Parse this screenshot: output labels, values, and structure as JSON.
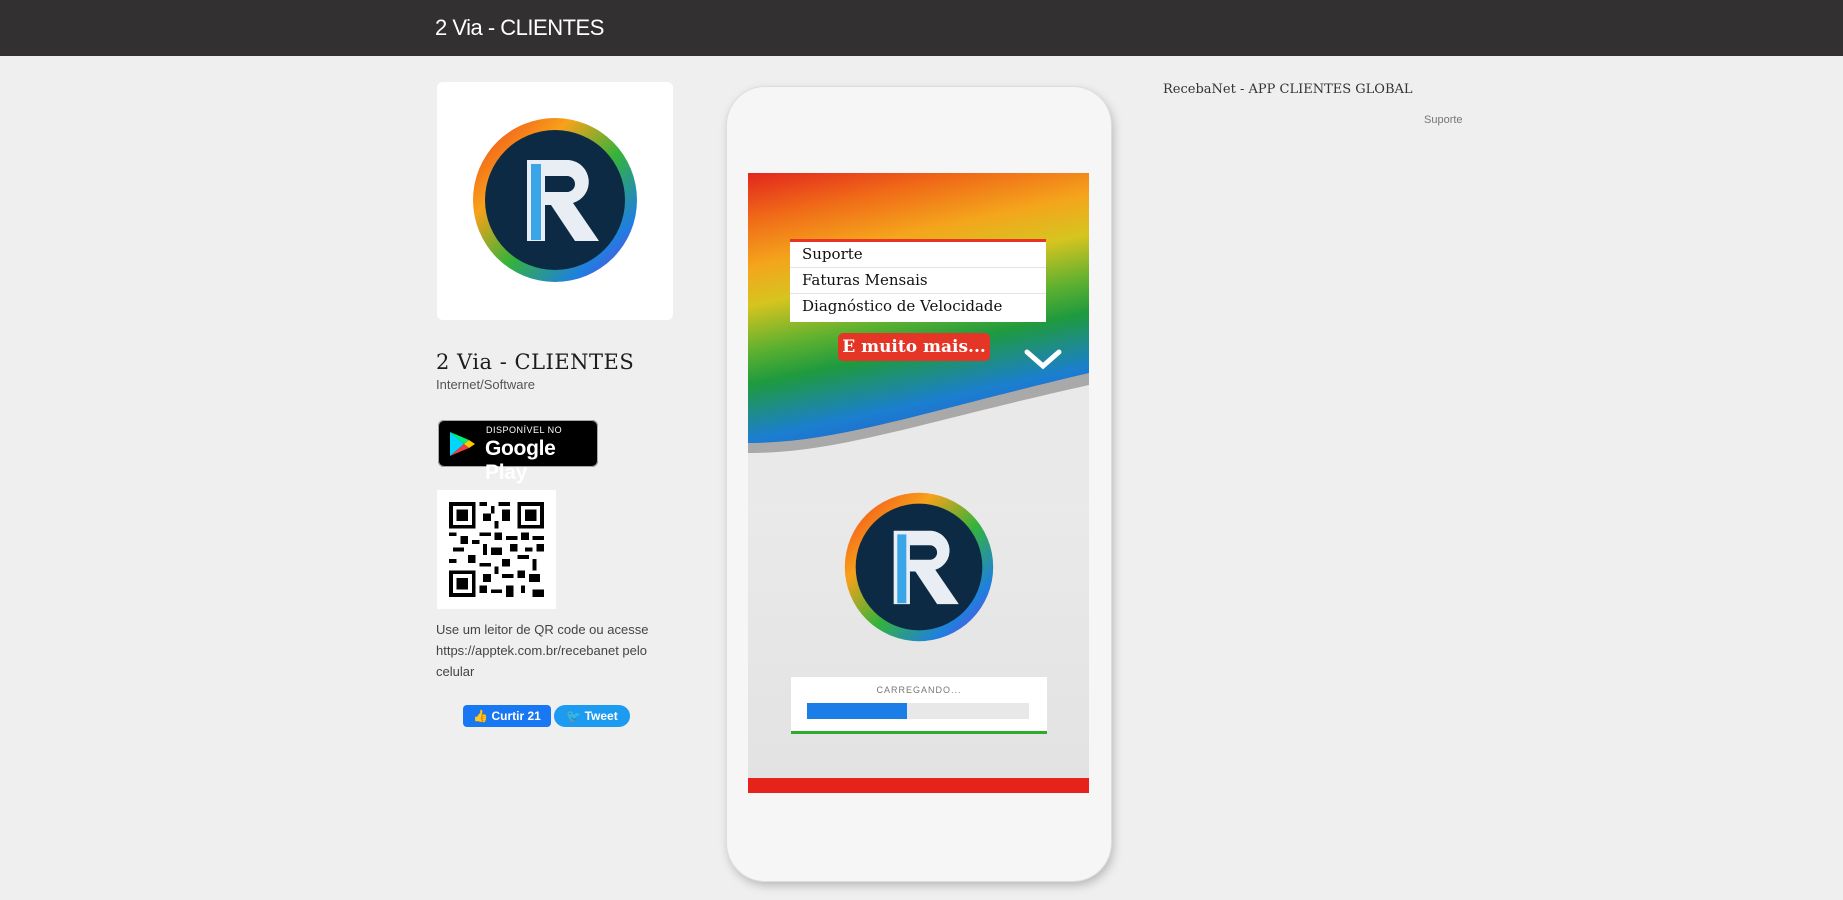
{
  "header": {
    "title": "2 Via - CLIENTES"
  },
  "app": {
    "name": "2 Via - CLIENTES",
    "category": "Internet/Software",
    "store_badge": {
      "small_label": "DISPONÍVEL NO",
      "store_name": "Google Play"
    },
    "qr_text": "Use um leitor de QR code ou acesse https://apptek.com.br/recebanet pelo celular",
    "social": {
      "facebook_label": "Curtir 21",
      "twitter_label": "Tweet"
    }
  },
  "screenshot": {
    "menu_items": [
      "Suporte",
      "Faturas Mensais",
      "Diagnóstico de Velocidade"
    ],
    "more_label": "E muito mais...",
    "loading_label": "CARREGANDO...",
    "loading_progress": 0.45
  },
  "right": {
    "heading": "RecebaNet - APP CLIENTES GLOBAL",
    "sub_link": "Suporte"
  },
  "colors": {
    "topbar": "#333031",
    "accent_red": "#e53527",
    "progress_blue": "#1a7ee6",
    "progress_green": "#2eaa2f"
  },
  "icons": [
    "r-logo-icon",
    "google-play-icon",
    "qr-code-icon",
    "chevron-down-icon",
    "facebook-like-icon",
    "twitter-icon"
  ]
}
